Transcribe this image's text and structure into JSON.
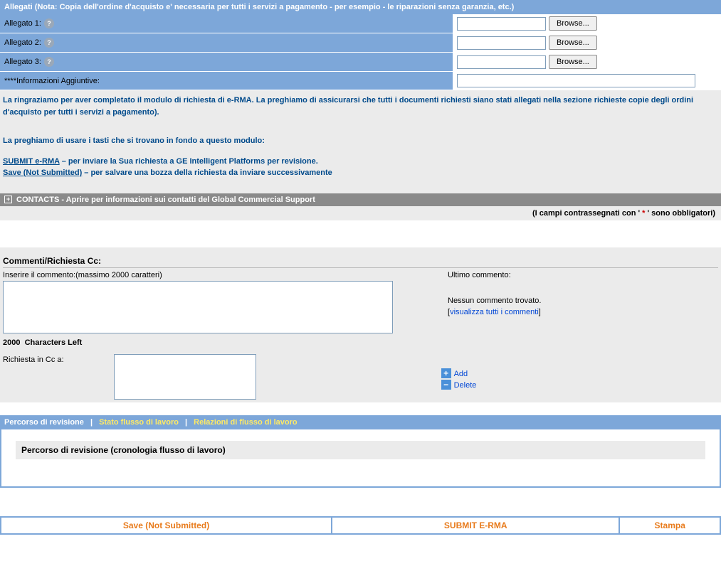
{
  "header": {
    "allegati_note": "Allegati (Nota: Copia dell'ordine d'acquisto e' necessaria per tutti i servizi a pagamento - per esempio - le riparazioni senza garanzia, etc.)"
  },
  "attachments": {
    "row1_label": "Allegato 1:",
    "row2_label": "Allegato 2:",
    "row3_label": "Allegato 3:",
    "browse": "Browse...",
    "addl_info_label": "****Informazioni Aggiuntive:"
  },
  "messages": {
    "thanks": "La ringraziamo per aver completato il modulo di richiesta di e-RMA.  La preghiamo di assicurarsi che tutti i documenti richiesti siano stati allegati nella sezione richieste copie degli ordini d'acquisto per tutti i servizi a pagamento).",
    "use_buttons": "La preghiamo di usare i tasti che si trovano in fondo a questo modulo:",
    "submit_link": "SUBMIT e-RMA",
    "submit_desc": " – per inviare la Sua richiesta a GE Intelligent Platforms per revisione.",
    "save_link": "Save (Not Submitted)",
    "save_desc": " – per salvare una bozza della richiesta da inviare successivamente"
  },
  "contacts": {
    "bar": "CONTACTS - Aprire per informazioni sui contatti del Global Commercial Support",
    "required_pre": "(I campi contrassegnati con ' ",
    "required_star": "*",
    "required_post": " ' sono obbligatori)"
  },
  "comments": {
    "title": "Commenti/Richiesta Cc:",
    "enter_label": "Inserire il commento:(massimo 2000 caratteri)",
    "chars_count": "2000",
    "chars_label": "Characters Left",
    "last_label": "Ultimo commento:",
    "none_found": "Nessun commento trovato.",
    "view_all": "visualizza tutti i commenti",
    "cc_label": "Richiesta in Cc a:",
    "add": "Add",
    "delete": "Delete"
  },
  "tabs": {
    "t1": "Percorso di revisione",
    "t2": "Stato flusso di lavoro",
    "t3": "Relazioni di flusso di lavoro",
    "panel_title": "Percorso di revisione (cronologia flusso di lavoro)"
  },
  "footer": {
    "save": "Save (Not Submitted)",
    "submit": "SUBMIT E-RMA",
    "print": "Stampa"
  }
}
